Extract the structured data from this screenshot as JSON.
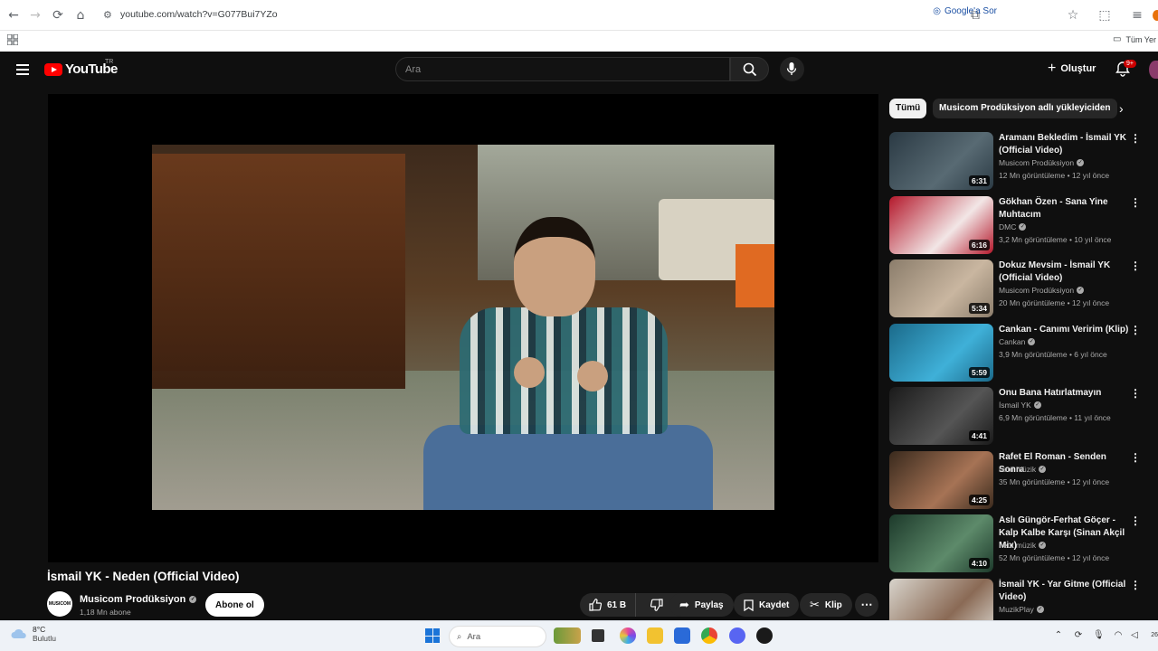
{
  "browser": {
    "url": "youtube.com/watch?v=G077Bui7YZo",
    "google_button": "Google'a Sor",
    "bookmarks_all": "Tüm Yer"
  },
  "header": {
    "logo_text": "YouTube",
    "region": "TR",
    "search_placeholder": "Ara",
    "create_label": "Oluştur",
    "notifications_badge": "9+"
  },
  "video": {
    "title": "İsmail YK - Neden (Official Video)",
    "channel": "Musicom Prodüksiyon",
    "subscribers": "1,18 Mn abone",
    "avatar_text": "MUSICOM",
    "subscribe_label": "Abone ol",
    "likes": "61 B",
    "share_label": "Paylaş",
    "save_label": "Kaydet",
    "clip_label": "Klip"
  },
  "chips": {
    "all": "Tümü",
    "uploader": "Musicom Prodüksiyon adlı yükleyiciden"
  },
  "recommendations": [
    {
      "title": "Aramanı Bekledim - İsmail YK (Official Video)",
      "channel": "Musicom Prodüksiyon",
      "verified": true,
      "meta": "12 Mn görüntüleme • 12 yıl önce",
      "duration": "6:31",
      "thumb_color": "#2b3a44",
      "thumb_accent": "#586a73"
    },
    {
      "title": "Gökhan Özen - Sana Yine Muhtacım",
      "channel": "DMC",
      "verified": true,
      "meta": "3,2 Mn görüntüleme • 10 yıl önce",
      "duration": "6:16",
      "thumb_color": "#b4182b",
      "thumb_accent": "#f2e6e6"
    },
    {
      "title": "Dokuz Mevsim - İsmail YK (Official Video)",
      "channel": "Musicom Prodüksiyon",
      "verified": true,
      "meta": "20 Mn görüntüleme • 12 yıl önce",
      "duration": "5:34",
      "thumb_color": "#8b7d6b",
      "thumb_accent": "#c9b6a0"
    },
    {
      "title": "Cankan - Canımı Veririm (Klip)",
      "channel": "Cankan",
      "verified": true,
      "meta": "3,9 Mn görüntüleme • 6 yıl önce",
      "duration": "5:59",
      "thumb_color": "#1b6a8a",
      "thumb_accent": "#3fb0d8"
    },
    {
      "title": "Onu Bana Hatırlatmayın",
      "channel": "İsmail YK",
      "verified": true,
      "meta": "6,9 Mn görüntüleme • 11 yıl önce",
      "duration": "4:41",
      "thumb_color": "#1a1a1a",
      "thumb_accent": "#555555"
    },
    {
      "title": "Rafet El Roman - Senden Sonra",
      "channel": "netd müzik",
      "verified": true,
      "meta": "35 Mn görüntüleme • 12 yıl önce",
      "duration": "4:25",
      "thumb_color": "#3a2a1d",
      "thumb_accent": "#a67355"
    },
    {
      "title": "Aslı Güngör-Ferhat Göçer - Kalp Kalbe Karşı (Sinan Akçil Mix)",
      "channel": "netd müzik",
      "verified": true,
      "meta": "52 Mn görüntüleme • 12 yıl önce",
      "duration": "4:10",
      "thumb_color": "#1d3a2b",
      "thumb_accent": "#5d8a6a"
    },
    {
      "title": "İsmail YK - Yar Gitme (Official Video)",
      "channel": "MuzikPlay",
      "verified": true,
      "meta": "",
      "duration": "",
      "thumb_color": "#d8d4cc",
      "thumb_accent": "#8a6a55"
    }
  ],
  "taskbar": {
    "temp": "8°C",
    "weather": "Bulutlu",
    "search_placeholder": "Ara",
    "clock": "26"
  },
  "colors": {
    "background": "#0f0f0f",
    "brand_red": "#ff0000",
    "text_secondary": "#aaaaaa"
  }
}
